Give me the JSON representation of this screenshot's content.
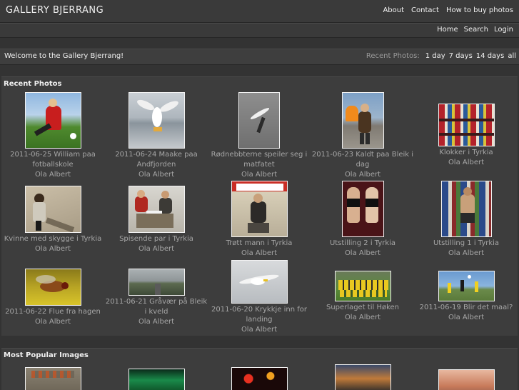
{
  "header": {
    "logo": "GALLERY BJERRANG",
    "nav": [
      "About",
      "Contact",
      "How to buy photos"
    ],
    "subnav": [
      "Home",
      "Search",
      "Login"
    ]
  },
  "welcome": {
    "text": "Welcome to the Gallery Bjerrang!",
    "recent_label": "Recent Photos:",
    "filters": [
      "1 day",
      "7 days",
      "14 days",
      "all"
    ]
  },
  "recent": {
    "title": "Recent Photos",
    "photos": [
      {
        "caption": "2011-06-25 William paa fotballskole",
        "author": "Ola Albert"
      },
      {
        "caption": "2011-06-24 Maake paa Andfjorden",
        "author": "Ola Albert"
      },
      {
        "caption": "Rødnebbterne speiler seg i matfatet",
        "author": "Ola Albert"
      },
      {
        "caption": "2011-06-23 Kaldt paa Bleik i dag",
        "author": "Ola Albert"
      },
      {
        "caption": "Klokker i Tyrkia",
        "author": "Ola Albert"
      },
      {
        "caption": "Kvinne med skygge i Tyrkia",
        "author": "Ola Albert"
      },
      {
        "caption": "Spisende par i Tyrkia",
        "author": "Ola Albert"
      },
      {
        "caption": "Trøtt mann i Tyrkia",
        "author": "Ola Albert"
      },
      {
        "caption": "Utstilling 2 i Tyrkia",
        "author": "Ola Albert"
      },
      {
        "caption": "Utstilling 1 i Tyrkia",
        "author": "Ola Albert"
      },
      {
        "caption": "2011-06-22 Flue fra hagen",
        "author": "Ola Albert"
      },
      {
        "caption": "2011-06-21 Gråvær på Bleik i kveld",
        "author": "Ola Albert"
      },
      {
        "caption": "2011-06-20 Krykkje inn for landing",
        "author": "Ola Albert"
      },
      {
        "caption": "Superlaget til Høken",
        "author": "Ola Albert"
      },
      {
        "caption": "2011-06-19 Blir det maal?",
        "author": "Ola Albert"
      }
    ]
  },
  "popular": {
    "title": "Most Popular Images"
  },
  "colors": {
    "background": "#333333",
    "panel": "#3d3d3d",
    "thumb_border": "#f2f2f2",
    "text": "#a6a6a6",
    "link": "#f0f0f0"
  }
}
